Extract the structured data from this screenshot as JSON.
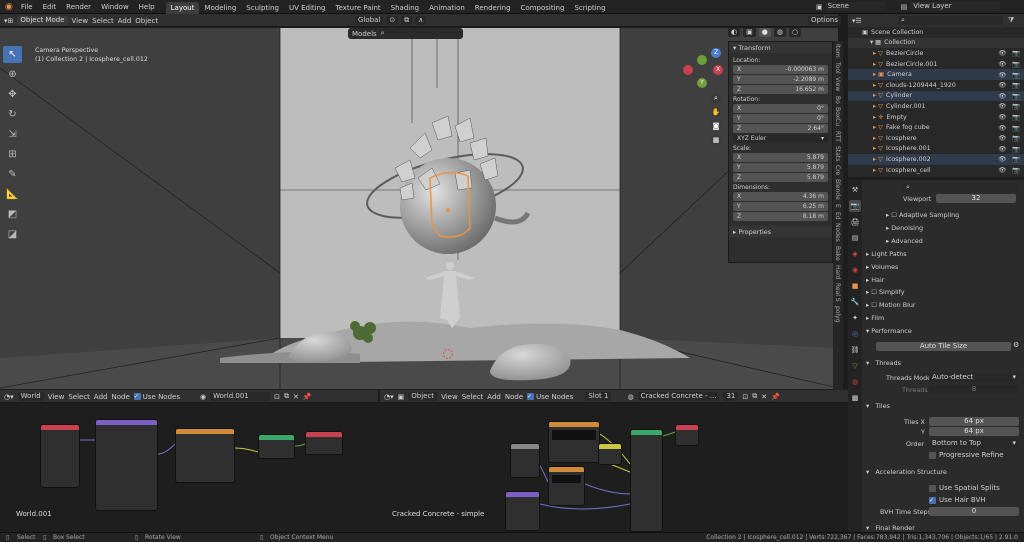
{
  "app": {
    "menu": [
      "File",
      "Edit",
      "Render",
      "Window",
      "Help"
    ],
    "workspaces": [
      "Layout",
      "Modeling",
      "Sculpting",
      "UV Editing",
      "Texture Paint",
      "Shading",
      "Animation",
      "Rendering",
      "Compositing",
      "Scripting"
    ],
    "active_workspace": "Layout",
    "scene": "Scene",
    "view_layer": "View Layer"
  },
  "viewport": {
    "mode": "Object Mode",
    "menus": [
      "View",
      "Select",
      "Add",
      "Object"
    ],
    "orientation": "Global",
    "options": "Options",
    "camera_label": "Camera Perspective",
    "collection_label": "(1) Collection 2 | Icosphere_cell.012",
    "models_label": "Models"
  },
  "transform": {
    "tab": "Transform",
    "location_label": "Location:",
    "location": [
      {
        "axis": "X",
        "value": "-0.000063 m"
      },
      {
        "axis": "Y",
        "value": "-2.2089 m"
      },
      {
        "axis": "Z",
        "value": "16.652 m"
      }
    ],
    "rotation_label": "Rotation:",
    "rotation": [
      {
        "axis": "X",
        "value": "0°"
      },
      {
        "axis": "Y",
        "value": "0°"
      },
      {
        "axis": "Z",
        "value": "2.64°"
      }
    ],
    "rotation_mode": "XYZ Euler",
    "scale_label": "Scale:",
    "scale": [
      {
        "axis": "X",
        "value": "5.879"
      },
      {
        "axis": "Y",
        "value": "5.879"
      },
      {
        "axis": "Z",
        "value": "5.879"
      }
    ],
    "dimensions_label": "Dimensions:",
    "dimensions": [
      {
        "axis": "X",
        "value": "4.36 m"
      },
      {
        "axis": "Y",
        "value": "6.25 m"
      },
      {
        "axis": "Z",
        "value": "8.18 m"
      }
    ],
    "properties": "Properties"
  },
  "sidebar_tabs": [
    "Item",
    "Tool",
    "View",
    "Bo",
    "BoxCu",
    "RTT",
    "Stats",
    "Cre",
    "Blende",
    "E",
    "Ed",
    "Nodes",
    "Bake",
    "Hard",
    "Real S",
    "polyg"
  ],
  "outliner": {
    "root": "Scene Collection",
    "collection": "Collection",
    "items": [
      "BezierCircle",
      "BezierCircle.001",
      "Camera",
      "clouds-1209444_1920",
      "Cylinder",
      "Cylinder.001",
      "Empty",
      "Fake fog cube",
      "Icosphere",
      "Icosphere.001",
      "Icosphere.002",
      "Icosphere_cell"
    ]
  },
  "properties": {
    "viewport_label": "Viewport",
    "viewport_value": "32",
    "sections": [
      "Adaptive Sampling",
      "Denoising",
      "Advanced",
      "Light Paths",
      "Volumes",
      "Hair",
      "Simplify",
      "Motion Blur",
      "Film",
      "Performance"
    ],
    "auto_tile": "Auto Tile Size",
    "threads": "Threads",
    "threads_mode_label": "Threads Mode",
    "threads_mode": "Auto-detect",
    "threads_label": "Threads",
    "threads_value": "8",
    "tiles": "Tiles",
    "tiles_x_label": "Tiles X",
    "tiles_x": "64 px",
    "tiles_y_label": "Y",
    "tiles_y": "64 px",
    "order_label": "Order",
    "order": "Bottom to Top",
    "progressive_refine": "Progressive Refine",
    "accel": "Acceleration Structure",
    "spatial_splits": "Use Spatial Splits",
    "hair_bvh": "Use Hair BVH",
    "bvh_steps_label": "BVH Time Steps",
    "bvh_steps": "0",
    "final_render": "Final Render"
  },
  "world_editor": {
    "type": "World",
    "menus": [
      "View",
      "Select",
      "Add",
      "Node"
    ],
    "use_nodes": "Use Nodes",
    "datablock": "World.001",
    "label": "World.001"
  },
  "shader_editor": {
    "type": "Object",
    "menus": [
      "View",
      "Select",
      "Add",
      "Node"
    ],
    "use_nodes": "Use Nodes",
    "slot": "Slot 1",
    "material": "Cracked Concrete - ...",
    "users": "31",
    "label": "Cracked Concrete - simple"
  },
  "status": {
    "select": "Select",
    "box_select": "Box Select",
    "rotate": "Rotate View",
    "context": "Object Context Menu",
    "stats": "Collection 2 | Icosphere_cell.012 | Verts:722,367 | Faces:783,942 | Tris:1,343,706 | Objects:1/65 | 2.91.0"
  },
  "colors": {
    "accent": "#4772b3",
    "select": "#e8944a"
  }
}
